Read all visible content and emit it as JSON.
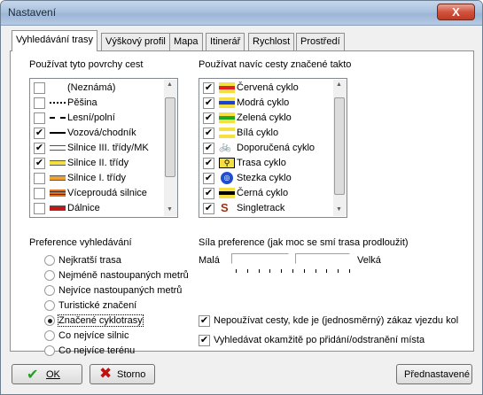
{
  "window": {
    "title": "Nastavení",
    "close_glyph": "X"
  },
  "tabs": [
    {
      "label": "Vyhledávání trasy",
      "active": true
    },
    {
      "label": "Výškový profil"
    },
    {
      "label": "Mapa"
    },
    {
      "label": "Itinerář"
    },
    {
      "label": "Rychlost"
    },
    {
      "label": "Prostředí"
    }
  ],
  "surfaces": {
    "heading": "Používat tyto povrchy cest",
    "items": [
      {
        "label": "(Neznámá)",
        "checked": false,
        "swatch": "none"
      },
      {
        "label": "Pěšina",
        "checked": false,
        "swatch": "dotted"
      },
      {
        "label": "Lesní/polní",
        "checked": false,
        "swatch": "dashed"
      },
      {
        "label": "Vozová/chodník",
        "checked": true,
        "swatch": "solid-black"
      },
      {
        "label": "Silnice III. třídy/MK",
        "checked": true,
        "swatch": "white-road"
      },
      {
        "label": "Silnice II. třídy",
        "checked": true,
        "swatch": "yellow-road"
      },
      {
        "label": "Silnice I. třídy",
        "checked": false,
        "swatch": "orange-road"
      },
      {
        "label": "Víceproudá silnice",
        "checked": false,
        "swatch": "multi-road"
      },
      {
        "label": "Dálnice",
        "checked": false,
        "swatch": "red-road"
      }
    ]
  },
  "marked": {
    "heading": "Používat navíc cesty značené takto",
    "items": [
      {
        "label": "Červená cyklo",
        "checked": true,
        "swatch": "#e02020"
      },
      {
        "label": "Modrá cyklo",
        "checked": true,
        "swatch": "#1f3fd0"
      },
      {
        "label": "Zelená cyklo",
        "checked": true,
        "swatch": "#1ea81e"
      },
      {
        "label": "Bílá cyklo",
        "checked": true,
        "swatch": "#ffffff"
      },
      {
        "label": "Doporučená cyklo",
        "checked": true,
        "swatch": "bike-icon"
      },
      {
        "label": "Trasa cyklo",
        "checked": true,
        "swatch": "bike-route-icon"
      },
      {
        "label": "Stezka cyklo",
        "checked": true,
        "swatch": "bike-path-icon"
      },
      {
        "label": "Černá cyklo",
        "checked": true,
        "swatch": "#000000"
      },
      {
        "label": "Singletrack",
        "checked": true,
        "swatch": "singletrack-icon"
      }
    ]
  },
  "preference": {
    "heading": "Preference vyhledávání",
    "options": [
      {
        "label": "Nejkratší trasa",
        "selected": false
      },
      {
        "label": "Nejméně nastoupaných metrů",
        "selected": false
      },
      {
        "label": "Nejvíce nastoupaných metrů",
        "selected": false
      },
      {
        "label": "Turistické značení",
        "selected": false
      },
      {
        "label": "Značené cyklotrasy",
        "selected": true
      },
      {
        "label": "Co nejvíce silnic",
        "selected": false
      },
      {
        "label": "Co nejvíce terénu",
        "selected": false
      }
    ]
  },
  "strength": {
    "heading": "Síla preference (jak moc se smí trasa prodloužit)",
    "min_label": "Malá",
    "max_label": "Velká"
  },
  "options": [
    {
      "label": "Nepoužívat cesty, kde je (jednosměrný) zákaz vjezdu kol",
      "checked": true
    },
    {
      "label": "Vyhledávat okamžitě po přidání/odstranění místa",
      "checked": true
    }
  ],
  "buttons": {
    "ok": "OK",
    "cancel": "Storno",
    "defaults": "Přednastavené"
  },
  "colors": {
    "title_bar": "#a9c1de",
    "close": "#c13a22",
    "ok_icon": "#22a022",
    "cancel_icon": "#c01010"
  }
}
